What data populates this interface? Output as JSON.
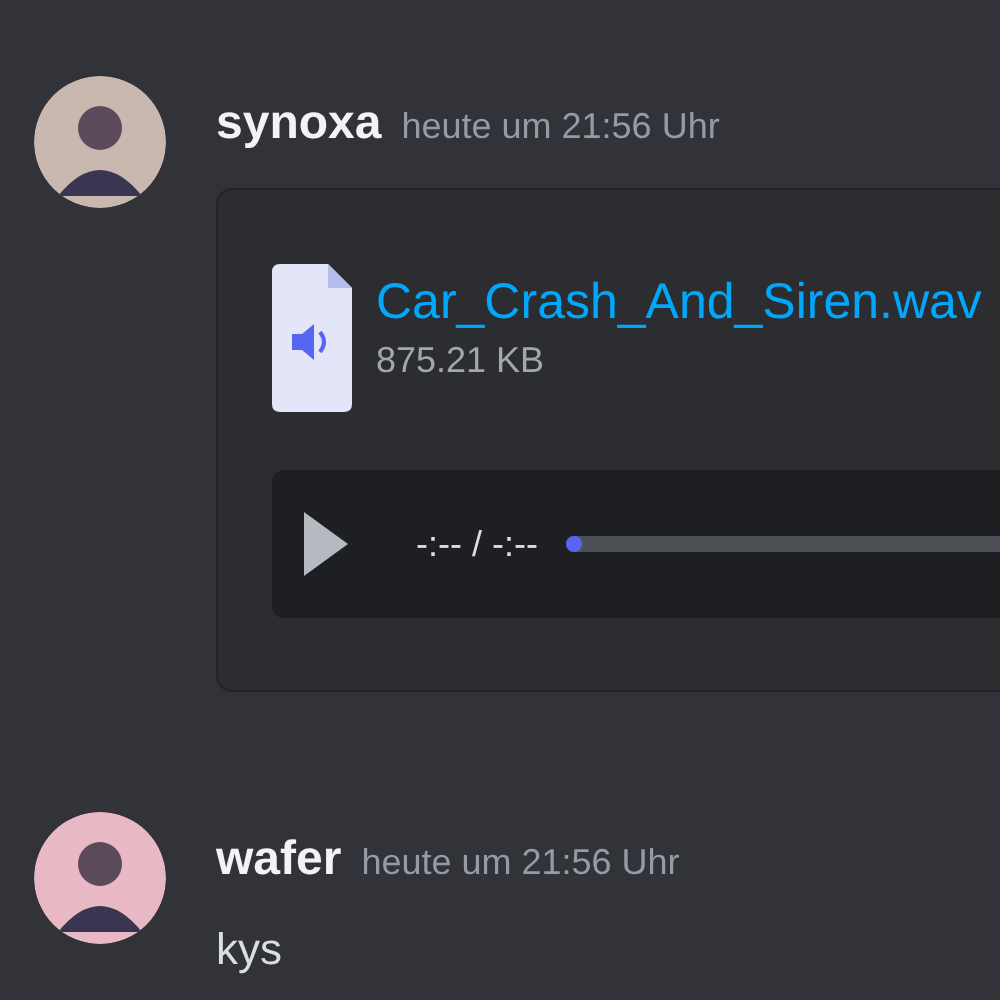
{
  "messages": [
    {
      "author": "synoxa",
      "timestamp": "heute um 21:56 Uhr",
      "attachment": {
        "filename": "Car_Crash_And_Siren.wav",
        "size": "875.21 KB",
        "player": {
          "time": "-:-- / -:--",
          "level": 0
        }
      }
    },
    {
      "author": "wafer",
      "timestamp": "heute um 21:56 Uhr",
      "text": "kys"
    }
  ]
}
